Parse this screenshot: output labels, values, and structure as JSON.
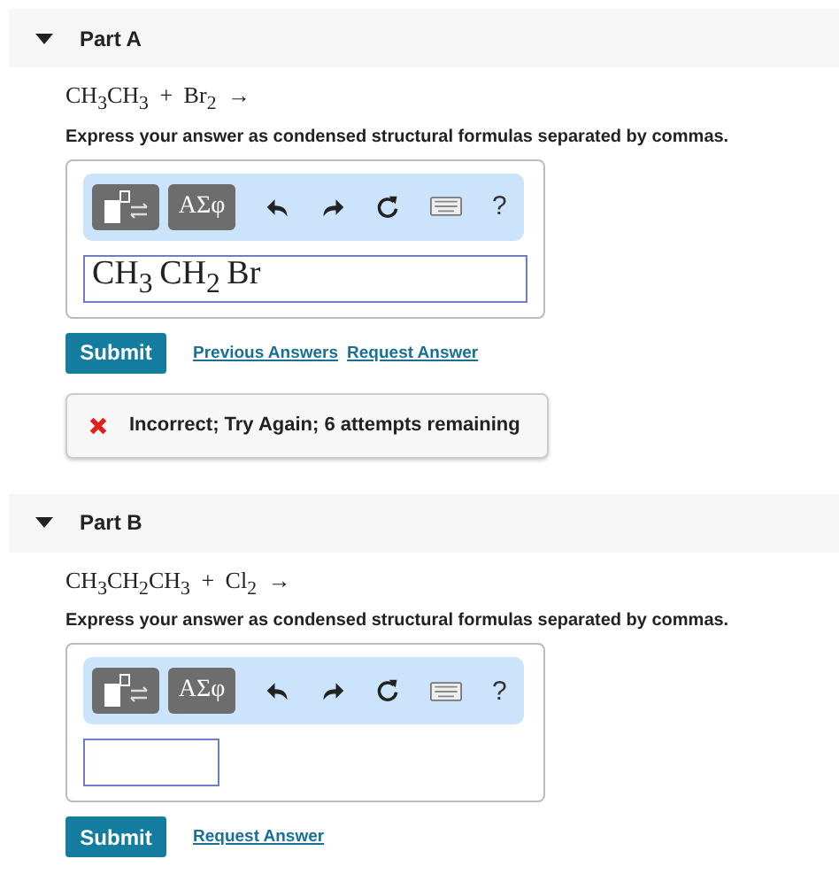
{
  "parts": [
    {
      "title": "Part A",
      "expanded": true,
      "equation": "CH$_{3}$CH$_{3}$ + Br$_{2}$ →",
      "instruction": "Express your answer as condensed structural formulas separated by commas.",
      "toolbar": {
        "symbols": "ΑΣφ",
        "help": "?"
      },
      "answer": "CH$_{3}$ CH$_{2}$ Br",
      "submit": "Submit",
      "links": [
        "Previous Answers",
        "Request Answer"
      ],
      "feedback": {
        "kind": "incorrect",
        "text": "Incorrect; Try Again; 6 attempts remaining"
      }
    },
    {
      "title": "Part B",
      "expanded": true,
      "equation": "CH$_{3}$CH$_{2}$CH$_{3}$ + Cl$_{2}$ →",
      "instruction": "Express your answer as condensed structural formulas separated by commas.",
      "toolbar": {
        "symbols": "ΑΣφ",
        "help": "?"
      },
      "submit": "Submit",
      "links": [
        "Request Answer"
      ]
    }
  ]
}
